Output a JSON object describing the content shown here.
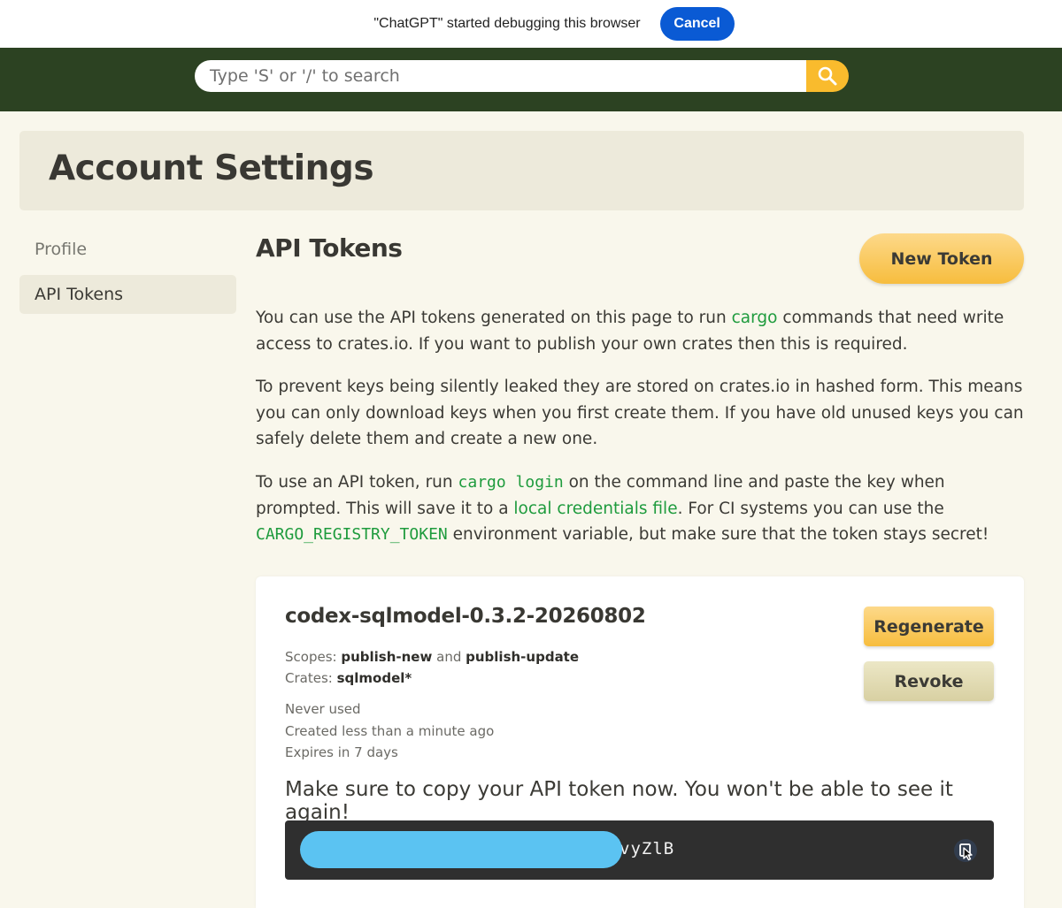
{
  "debug_bar": {
    "message": "\"ChatGPT\" started debugging this browser",
    "cancel_label": "Cancel"
  },
  "header": {
    "search_placeholder": "Type 'S' or '/' to search",
    "search_icon": "magnifier-icon"
  },
  "page": {
    "title": "Account Settings"
  },
  "sidebar": {
    "items": [
      {
        "label": "Profile",
        "active": false
      },
      {
        "label": "API Tokens",
        "active": true
      }
    ]
  },
  "main": {
    "section_title": "API Tokens",
    "new_token_label": "New Token",
    "p1": {
      "before": "You can use the API tokens generated on this page to run ",
      "link": "cargo",
      "after": " commands that need write access to crates.io. If you want to publish your own crates then this is required."
    },
    "p2": "To prevent keys being silently leaked they are stored on crates.io in hashed form. This means you can only download keys when you first create them. If you have old unused keys you can safely delete them and create a new one.",
    "p3": {
      "a": "To use an API token, run ",
      "code1": "cargo login",
      "b": " on the command line and paste the key when prompted. This will save it to a ",
      "link": "local credentials file",
      "c": ". For CI systems you can use the ",
      "code2": "CARGO_REGISTRY_TOKEN",
      "d": " environment variable, but make sure that the token stays secret!"
    }
  },
  "token": {
    "name": "codex-sqlmodel-0.3.2-20260802",
    "scopes_label": "Scopes:",
    "scope1": "publish-new",
    "scope_and": "and",
    "scope2": "publish-update",
    "crates_label": "Crates:",
    "crates_value": "sqlmodel*",
    "last_used": "Never used",
    "created": "Created less than a minute ago",
    "expires": "Expires in 7 days",
    "regenerate_label": "Regenerate",
    "revoke_label": "Revoke",
    "copy_warning": "Make sure to copy your API token now. You won't be able to see it again!",
    "value_visible": "vyZlB",
    "copy_icon": "copy-icon"
  },
  "colors": {
    "header_bg": "#2c4222",
    "accent_yellow": "#f9bb2d",
    "link_green": "#1e9b3d",
    "cancel_blue": "#0a5ad4",
    "redaction_blue": "#5bc3f2"
  }
}
